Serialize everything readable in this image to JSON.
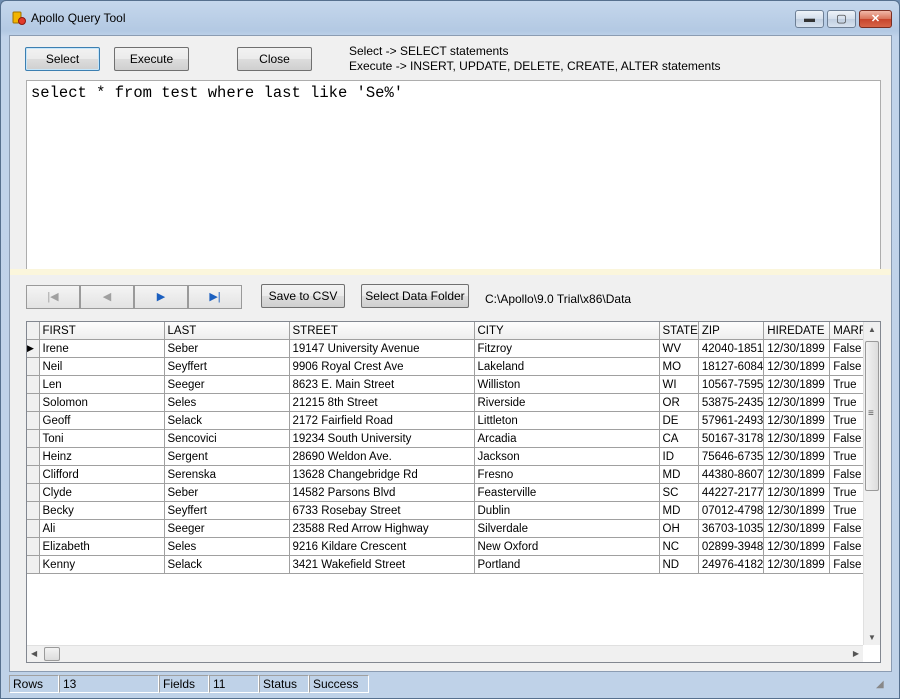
{
  "window": {
    "title": "Apollo Query Tool",
    "minimize_glyph": "▬",
    "maximize_glyph": "▢",
    "close_glyph": "✕"
  },
  "toolbar": {
    "select_label": "Select",
    "execute_label": "Execute",
    "close_label": "Close",
    "hint_select": "Select -> SELECT statements",
    "hint_execute": "Execute -> INSERT, UPDATE, DELETE, CREATE, ALTER statements"
  },
  "editor": {
    "query": "select * from test where last like 'Se%'"
  },
  "navigator": {
    "first_glyph": "|◀",
    "prior_glyph": "◀",
    "next_glyph": "▶",
    "last_glyph": "▶|",
    "save_csv_label": "Save to CSV",
    "select_folder_label": "Select Data Folder",
    "data_path": "C:\\Apollo\\9.0 Trial\\x86\\Data"
  },
  "grid": {
    "columns": [
      "FIRST",
      "LAST",
      "STREET",
      "CITY",
      "STATE",
      "ZIP",
      "HIREDATE",
      "MARR"
    ],
    "current_row_marker": "▶",
    "rows": [
      [
        "Irene",
        "Seber",
        "19147 University Avenue",
        "Fitzroy",
        "WV",
        "42040-1851",
        "12/30/1899",
        "False"
      ],
      [
        "Neil",
        "Seyffert",
        "9906 Royal Crest Ave",
        "Lakeland",
        "MO",
        "18127-6084",
        "12/30/1899",
        "False"
      ],
      [
        "Len",
        "Seeger",
        "8623 E. Main Street",
        "Williston",
        "WI",
        "10567-7595",
        "12/30/1899",
        "True"
      ],
      [
        "Solomon",
        "Seles",
        "21215 8th Street",
        "Riverside",
        "OR",
        "53875-2435",
        "12/30/1899",
        "True"
      ],
      [
        "Geoff",
        "Selack",
        "2172 Fairfield Road",
        "Littleton",
        "DE",
        "57961-2493",
        "12/30/1899",
        "True"
      ],
      [
        "Toni",
        "Sencovici",
        "19234 South University",
        "Arcadia",
        "CA",
        "50167-3178",
        "12/30/1899",
        "False"
      ],
      [
        "Heinz",
        "Sergent",
        "28690 Weldon Ave.",
        "Jackson",
        "ID",
        "75646-6735",
        "12/30/1899",
        "True"
      ],
      [
        "Clifford",
        "Serenska",
        "13628 Changebridge Rd",
        "Fresno",
        "MD",
        "44380-8607",
        "12/30/1899",
        "False"
      ],
      [
        "Clyde",
        "Seber",
        "14582 Parsons Blvd",
        "Feasterville",
        "SC",
        "44227-2177",
        "12/30/1899",
        "True"
      ],
      [
        "Becky",
        "Seyffert",
        "6733 Rosebay Street",
        "Dublin",
        "MD",
        "07012-4798",
        "12/30/1899",
        "True"
      ],
      [
        "Ali",
        "Seeger",
        "23588 Red Arrow Highway",
        "Silverdale",
        "OH",
        "36703-1035",
        "12/30/1899",
        "False"
      ],
      [
        "Elizabeth",
        "Seles",
        "9216 Kildare Crescent",
        "New Oxford",
        "NC",
        "02899-3948",
        "12/30/1899",
        "False"
      ],
      [
        "Kenny",
        "Selack",
        "3421 Wakefield Street",
        "Portland",
        "ND",
        "24976-4182",
        "12/30/1899",
        "False"
      ]
    ]
  },
  "statusbar": {
    "rows_label": "Rows",
    "rows_value": "13",
    "fields_label": "Fields",
    "fields_value": "11",
    "status_label": "Status",
    "status_value": "Success"
  },
  "colors": {
    "title_bar": "#bfd2e8",
    "client_bg": "#f0f0f0",
    "splitter": "#fbf6dc",
    "nav_enabled": "#1b5fbf",
    "close_button": "#c7442b"
  }
}
